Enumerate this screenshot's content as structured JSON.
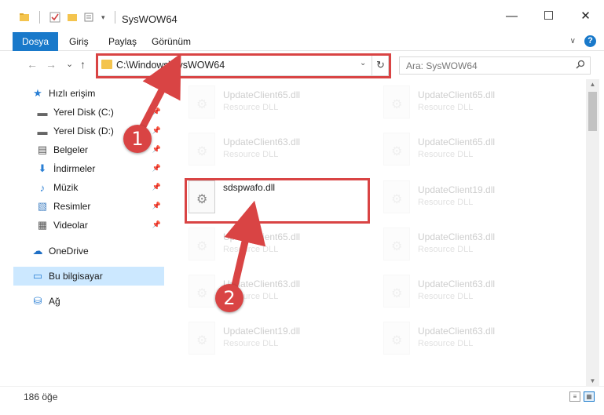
{
  "window": {
    "title": "SysWOW64",
    "minimize": "—",
    "maximize": "☐",
    "close": "✕"
  },
  "ribbon": {
    "tabs": [
      "Dosya",
      "Giriş",
      "Paylaş",
      "Görünüm"
    ],
    "expand": "∨",
    "help": "?"
  },
  "nav": {
    "back": "←",
    "forward": "→",
    "recent": "⌄",
    "up": "↑",
    "address": "C:\\Windows\\SysWOW64",
    "search_placeholder": "Ara: SysWOW64",
    "refresh": "↻",
    "search_icon": "⌕"
  },
  "sidebar": {
    "items": [
      {
        "label": "Hızlı erişim",
        "icon": "star-icon",
        "glyph": "★",
        "pinned": false
      },
      {
        "label": "Yerel Disk (C:)",
        "icon": "disk-icon",
        "glyph": "▬",
        "pinned": true
      },
      {
        "label": "Yerel Disk (D:)",
        "icon": "disk-icon",
        "glyph": "▬",
        "pinned": true
      },
      {
        "label": "Belgeler",
        "icon": "documents-icon",
        "glyph": "▤",
        "pinned": true
      },
      {
        "label": "İndirmeler",
        "icon": "download-icon",
        "glyph": "⬇",
        "pinned": true
      },
      {
        "label": "Müzik",
        "icon": "music-icon",
        "glyph": "♪",
        "pinned": true
      },
      {
        "label": "Resimler",
        "icon": "pictures-icon",
        "glyph": "▧",
        "pinned": true
      },
      {
        "label": "Videolar",
        "icon": "video-icon",
        "glyph": "▦",
        "pinned": true
      },
      {
        "label": "OneDrive",
        "icon": "cloud-icon",
        "glyph": "☁",
        "pinned": false
      },
      {
        "label": "Bu bilgisayar",
        "icon": "computer-icon",
        "glyph": "▭",
        "pinned": false
      },
      {
        "label": "Ağ",
        "icon": "network-icon",
        "glyph": "⛁",
        "pinned": false
      }
    ]
  },
  "files": {
    "left": [
      {
        "name": "UpdateClient65.dll",
        "type": "Resource DLL"
      },
      {
        "name": "UpdateClient63.dll",
        "type": "Resource DLL"
      },
      {
        "name": "sdspwafo.dll",
        "type": ""
      },
      {
        "name": "UpdateClient65.dll",
        "type": "Resource DLL"
      },
      {
        "name": "UpdateClient63.dll",
        "type": "Resource DLL"
      },
      {
        "name": "UpdateClient19.dll",
        "type": "Resource DLL"
      }
    ],
    "right": [
      {
        "name": "UpdateClient65.dll",
        "type": "Resource DLL"
      },
      {
        "name": "UpdateClient65.dll",
        "type": "Resource DLL"
      },
      {
        "name": "UpdateClient19.dll",
        "type": "Resource DLL"
      },
      {
        "name": "UpdateClient63.dll",
        "type": "Resource DLL"
      },
      {
        "name": "UpdateClient63.dll",
        "type": "Resource DLL"
      },
      {
        "name": "UpdateClient63.dll",
        "type": "Resource DLL"
      }
    ]
  },
  "status": {
    "count": "186 öğe"
  },
  "annotations": {
    "step1": "1",
    "step2": "2",
    "color": "#d94444"
  }
}
